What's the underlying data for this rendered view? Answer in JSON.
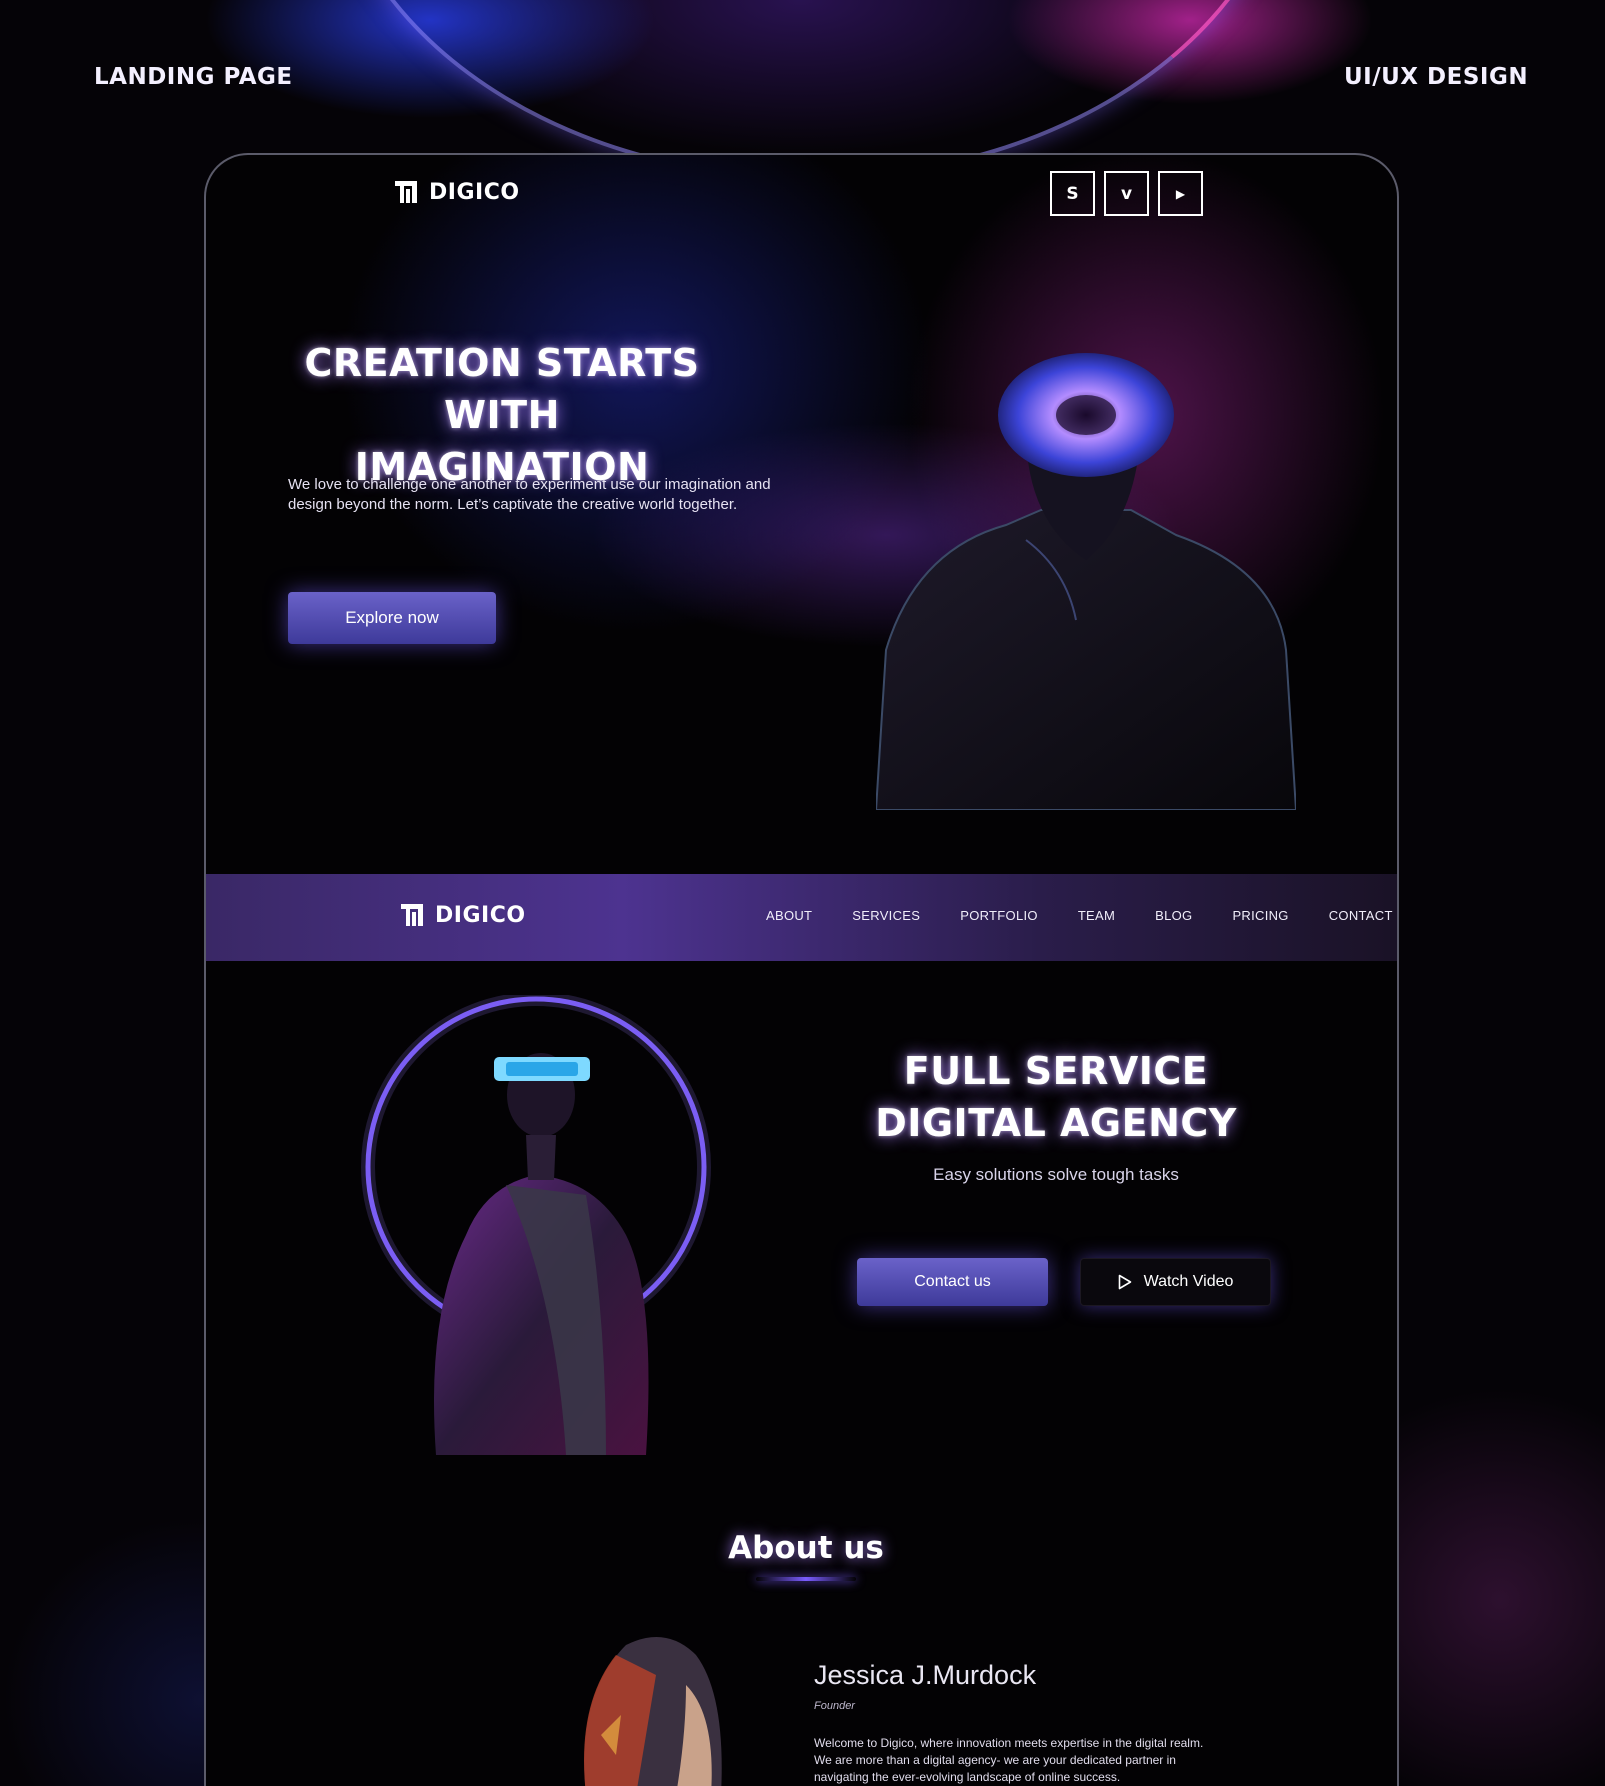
{
  "labels": {
    "left": "LANDING PAGE",
    "right": "UI/UX DESIGN"
  },
  "brand": {
    "name": "DIGICO"
  },
  "socials": [
    {
      "icon": "skype-icon",
      "glyph": "S"
    },
    {
      "icon": "vimeo-icon",
      "glyph": "v"
    },
    {
      "icon": "youtube-icon",
      "glyph": "▶"
    }
  ],
  "hero": {
    "title_line1": "CREATION STARTS",
    "title_line2": "WITH IMAGINATION",
    "description": "We love to challenge one another to experiment use our imagination and design beyond the norm. Let’s captivate the creative world together.",
    "cta": "Explore now"
  },
  "nav": {
    "items": [
      "ABOUT",
      "SERVICES",
      "PORTFOLIO",
      "TEAM",
      "BLOG",
      "PRICING",
      "CONTACT"
    ]
  },
  "agency": {
    "title_line1": "FULL SERVICE",
    "title_line2": "DIGITAL AGENCY",
    "subtitle": "Easy solutions solve tough tasks",
    "contact_label": "Contact us",
    "video_label": "Watch Video"
  },
  "about": {
    "title": "About us",
    "name": "Jessica J.Murdock",
    "role": "Founder",
    "bio": "Welcome to Digico, where innovation meets expertise in the digital realm. We are more than a digital agency- we are your dedicated partner in navigating the ever-evolving landscape of online success."
  },
  "colors": {
    "accent": "#6a62c9",
    "ring": "#7b5cff",
    "background": "#050307"
  }
}
